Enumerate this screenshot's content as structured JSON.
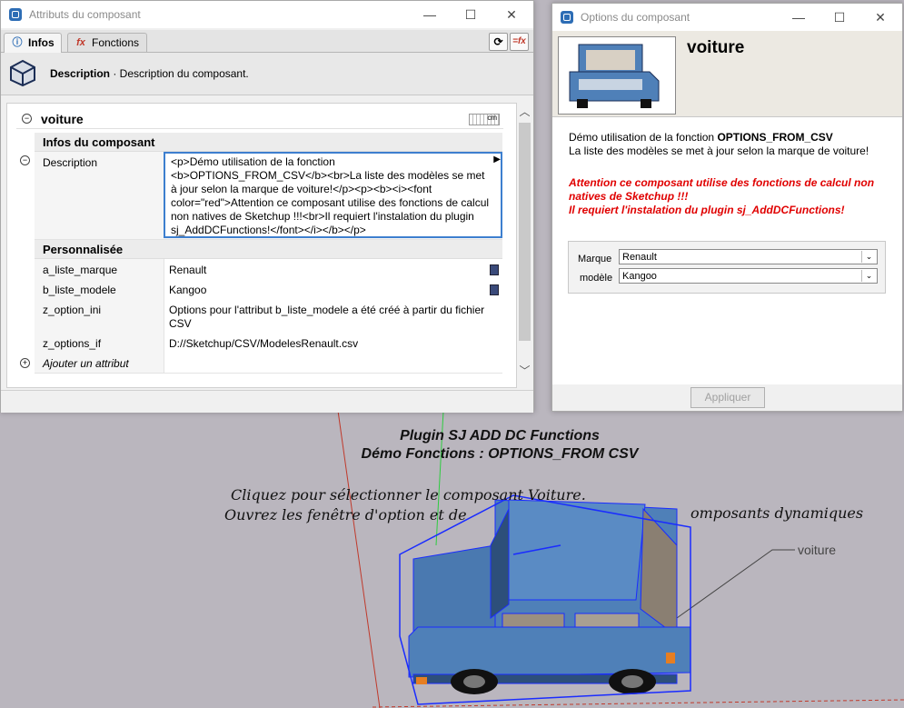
{
  "attr_window": {
    "title": "Attributs du composant",
    "tabs": [
      {
        "label": "Infos",
        "icon": "info-icon"
      },
      {
        "label": "Fonctions",
        "icon": "fx-icon"
      }
    ],
    "desc_label": "Description",
    "desc_text": " · Description du composant.",
    "unit": "cm",
    "component_name": "voiture",
    "section_info": "Infos du composant",
    "description_key": "Description",
    "description_value": "<p>Démo utilisation de la fonction <b>OPTIONS_FROM_CSV</b><br>La liste des modèles se met à jour selon la marque de voiture!</p><p><b><i><font color=\"red\">Attention ce composant utilise des fonctions de calcul non natives de Sketchup !!!<br>Il requiert l'instalation du plugin sj_AddDCFunctions!</font></i></b></p>",
    "section_custom": "Personnalisée",
    "rows": [
      {
        "key": "a_liste_marque",
        "value": "Renault"
      },
      {
        "key": "b_liste_modele",
        "value": "Kangoo"
      },
      {
        "key": "z_option_ini",
        "value": "Options pour l'attribut b_liste_modele a été créé à partir du fichier CSV"
      },
      {
        "key": "z_options_if",
        "value": "D://Sketchup/CSV/ModelesRenault.csv"
      }
    ],
    "add_attribute": "Ajouter un attribut"
  },
  "opt_window": {
    "title": "Options du composant",
    "name": "voiture",
    "line1_prefix": "Démo utilisation de la fonction ",
    "line1_bold": "OPTIONS_FROM_CSV",
    "line2": "La liste des modèles se met à jour selon la marque de voiture!",
    "warning1": "Attention ce composant utilise des fonctions de calcul non",
    "warning2": "natives de Sketchup !!!",
    "warning3": "Il requiert l'instalation du plugin sj_AddDCFunctions!",
    "marque_label": "Marque",
    "marque_value": "Renault",
    "modele_label": "modèle",
    "modele_value": "Kangoo",
    "apply": "Appliquer"
  },
  "scene": {
    "title1": "Plugin SJ ADD DC Functions",
    "title2": "Démo Fonctions : OPTIONS_FROM CSV",
    "hint1": "Cliquez pour sélectionner le composant Voiture.",
    "hint2a": "Ouvrez les fenêtre d'option et de",
    "hint2b": "omposants dynamiques",
    "leader_label": "voiture"
  },
  "colors": {
    "car_body": "#4f80b8",
    "selection": "#1a2cff",
    "warning": "#e00000",
    "edit_focus": "#3d7fcf"
  }
}
